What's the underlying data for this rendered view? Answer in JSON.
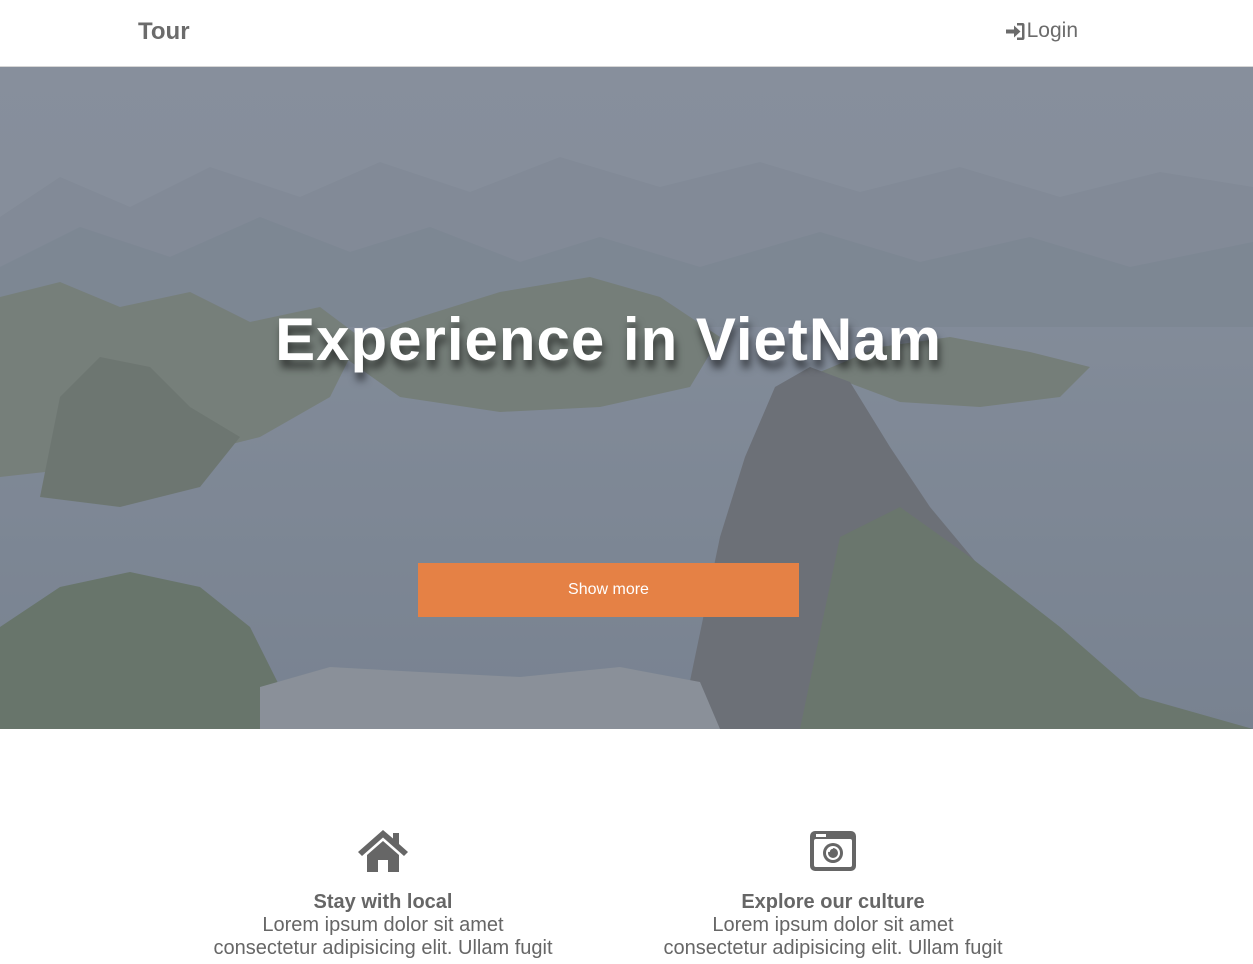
{
  "nav": {
    "brand": "Tour",
    "login_label": "Login",
    "login_icon": "sign-in-icon"
  },
  "hero": {
    "title": "Experience in VietNam",
    "button_label": "Show more",
    "button_color": "#e58145",
    "background_image": "mountain-bay-landscape"
  },
  "features": [
    {
      "icon": "home-icon",
      "title": "Stay with local",
      "line1": "Lorem ipsum dolor sit amet",
      "line2": "consectetur adipisicing elit. Ullam fugit"
    },
    {
      "icon": "camera-icon",
      "title": "Explore our culture",
      "line1": "Lorem ipsum dolor sit amet",
      "line2": "consectetur adipisicing elit. Ullam fugit"
    }
  ]
}
